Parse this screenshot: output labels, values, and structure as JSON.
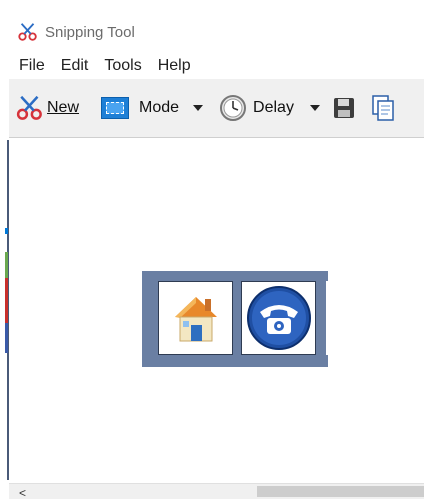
{
  "window": {
    "title": "Snipping Tool",
    "app_icon": "scissors-icon"
  },
  "menu": {
    "items": [
      "File",
      "Edit",
      "Tools",
      "Help"
    ]
  },
  "toolbar": {
    "new_label": "New",
    "new_icon": "scissors-icon",
    "mode_label": "Mode",
    "mode_icon": "rectangle-snip-icon",
    "delay_label": "Delay",
    "delay_icon": "clock-icon",
    "save_icon": "floppy-disk-icon",
    "copy_icon": "copy-icon"
  },
  "snip": {
    "tiles": [
      {
        "icon": "house-icon"
      },
      {
        "icon": "telephone-icon"
      }
    ],
    "background_color": "#6a7fa3"
  },
  "scrollbar": {
    "left_arrow": "<"
  },
  "colors": {
    "toolbar_bg": "#f0f0f0",
    "accent_blue": "#1e7fd6",
    "scissors_red": "#d6333b"
  }
}
